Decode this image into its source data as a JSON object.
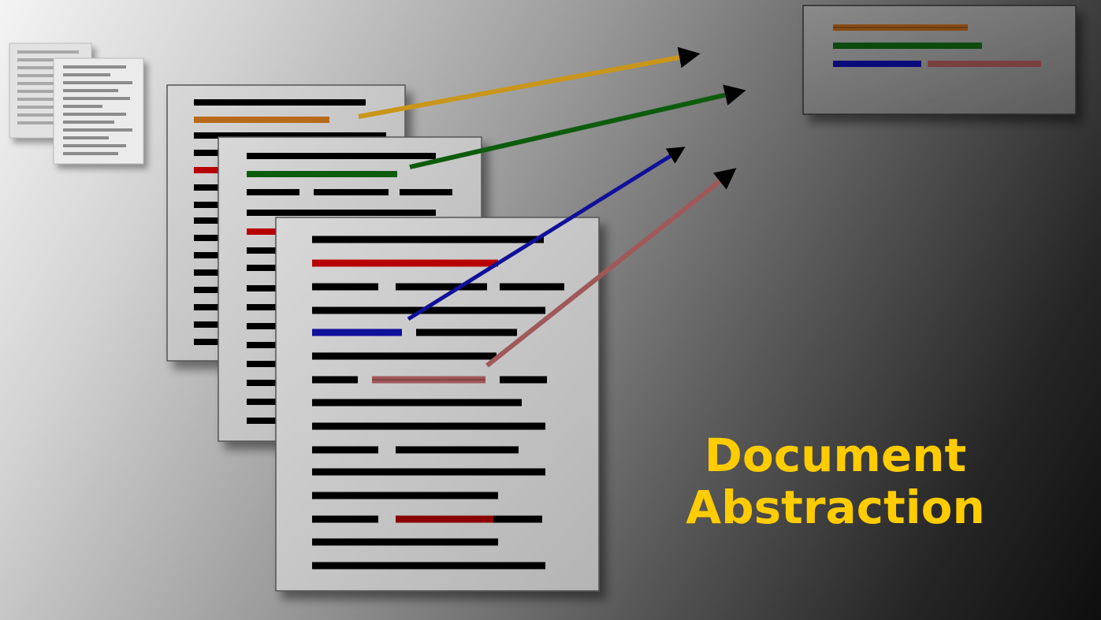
{
  "title": {
    "line1": "Document",
    "line2": "Abstraction"
  },
  "colors": {
    "title": "#ffcc00",
    "orange": "#b86a18",
    "gold": "#c9961a",
    "green": "#0d5c0d",
    "blue": "#10109a",
    "rose": "#a05858",
    "red": "#b80000",
    "dark_red": "#8a0000"
  },
  "icons": [
    "document-stack-icon",
    "arrow-icon",
    "summary-document-icon"
  ]
}
